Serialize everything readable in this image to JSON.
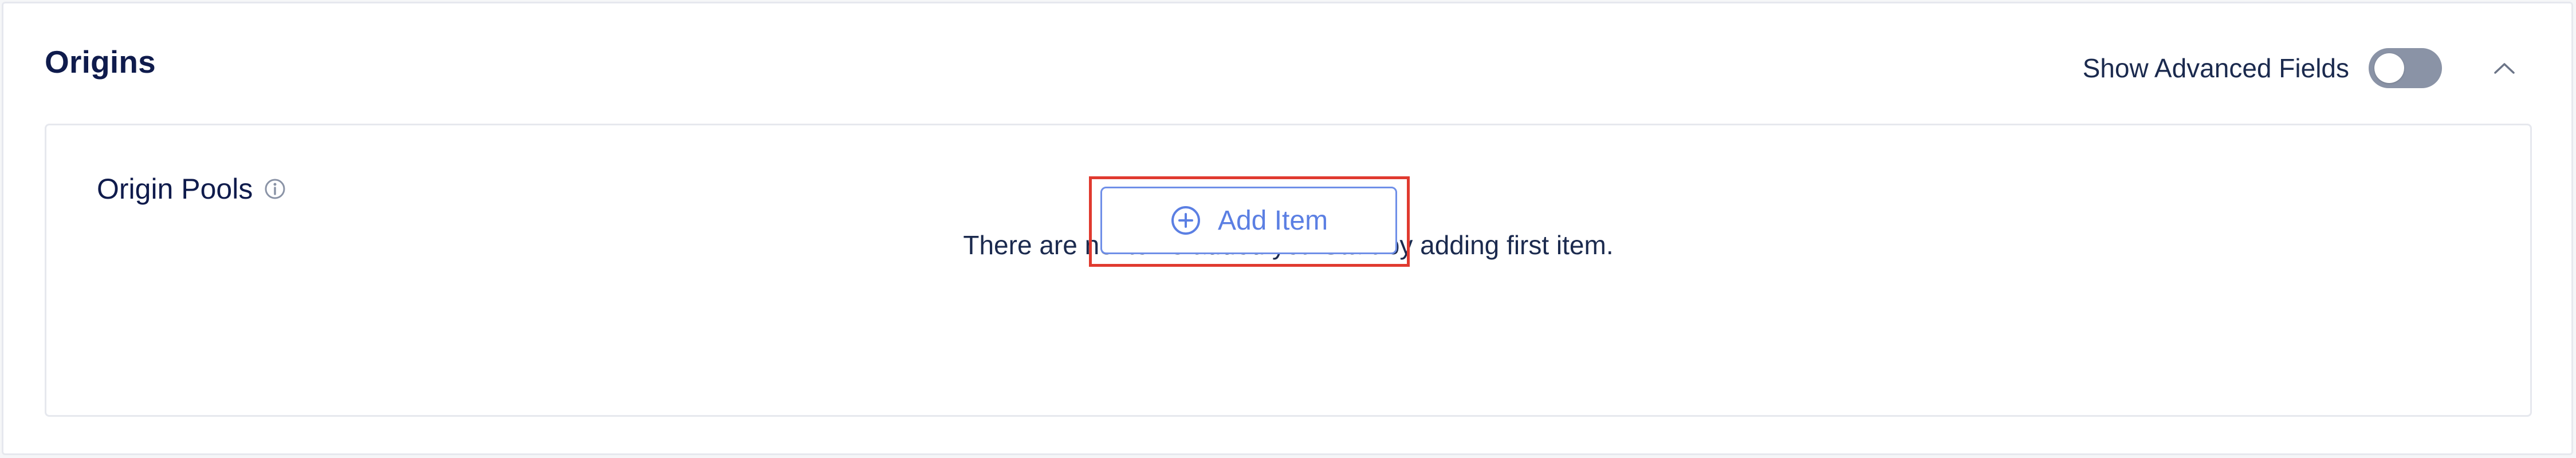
{
  "panel": {
    "title": "Origins",
    "advanced_label": "Show Advanced Fields",
    "advanced_enabled": false
  },
  "origin_pools": {
    "label": "Origin Pools",
    "empty_message": "There are no items added yet. Start by adding first item.",
    "add_button_label": "Add Item"
  },
  "colors": {
    "accent": "#5b7fe3",
    "highlight": "#e03a2f",
    "title": "#0f1b4c",
    "toggle_off": "#8a93a6"
  },
  "icons": {
    "collapse": "chevron-up-icon",
    "info": "info-icon",
    "add": "plus-circle-icon"
  }
}
